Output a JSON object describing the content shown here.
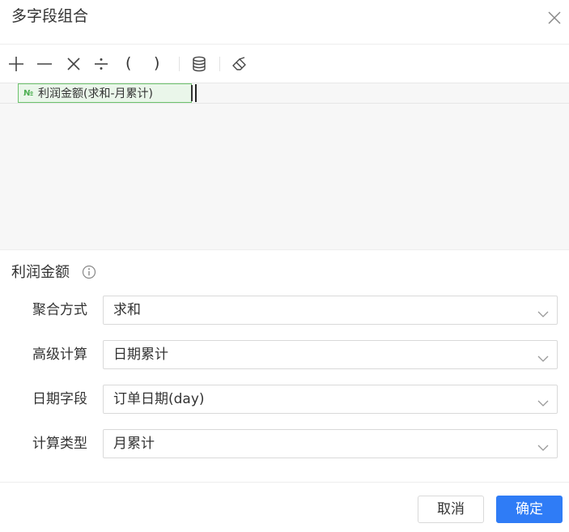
{
  "dialog": {
    "title": "多字段组合",
    "close_icon": "close-icon"
  },
  "toolbar": {
    "plus_icon": "plus-icon",
    "minus_icon": "minus-icon",
    "multiply_icon": "multiply-icon",
    "divide_icon": "divide-icon",
    "open_paren": "(",
    "close_paren": ")",
    "database_icon": "database-icon",
    "clear_icon": "eraser-icon"
  },
  "editor": {
    "chip_icon": "№",
    "chip_text": "利润金额(求和-月累计)"
  },
  "field": {
    "title": "利润金额",
    "info_icon": "info-icon"
  },
  "form": {
    "rows": [
      {
        "label": "聚合方式",
        "value": "求和"
      },
      {
        "label": "高级计算",
        "value": "日期累计"
      },
      {
        "label": "日期字段",
        "value": "订单日期(day)"
      },
      {
        "label": "计算类型",
        "value": "月累计"
      }
    ]
  },
  "footer": {
    "cancel_label": "取消",
    "ok_label": "确定"
  },
  "colors": {
    "primary": "#2f7cf6",
    "chip_bg": "#eaf6ea",
    "chip_border": "#6dc36d",
    "editor_bg": "#f7f7f7"
  }
}
